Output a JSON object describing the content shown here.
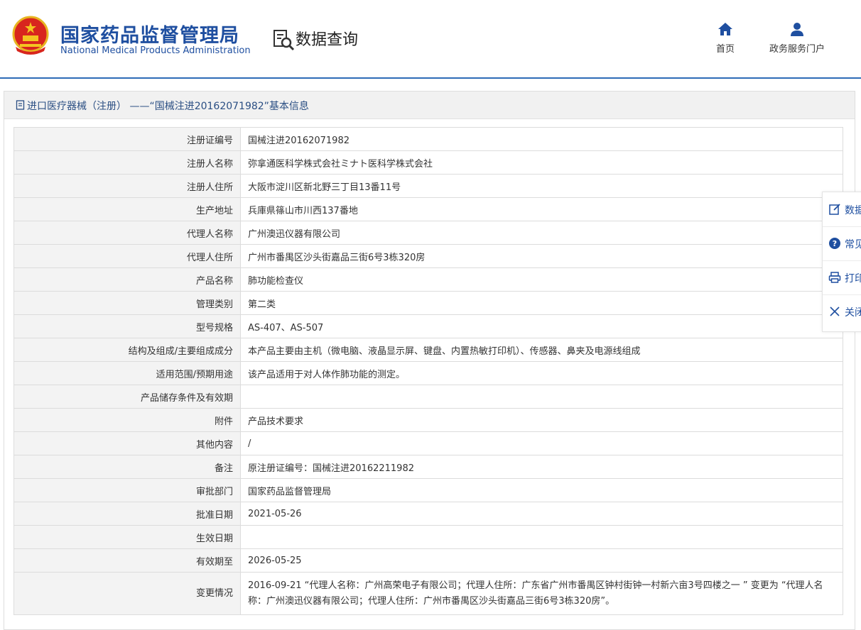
{
  "header": {
    "title_cn": "国家药品监督管理局",
    "title_en": "National Medical Products Administration",
    "section": "数据查询",
    "nav": [
      {
        "label": "首页",
        "icon": "home-icon"
      },
      {
        "label": "政务服务门户",
        "icon": "user-icon"
      }
    ]
  },
  "panel": {
    "title": "进口医疗器械（注册） ——“国械注进20162071982”基本信息"
  },
  "rows": [
    {
      "k": "注册证编号",
      "v": "国械注进20162071982"
    },
    {
      "k": "注册人名称",
      "v": "弥拿通医科学株式会社ミナト医科学株式会社"
    },
    {
      "k": "注册人住所",
      "v": "大阪市淀川区新北野三丁目13番11号"
    },
    {
      "k": "生产地址",
      "v": "兵庫県篠山市川西137番地"
    },
    {
      "k": "代理人名称",
      "v": "广州澳迅仪器有限公司"
    },
    {
      "k": "代理人住所",
      "v": "广州市番禺区沙头街嘉品三街6号3栋320房"
    },
    {
      "k": "产品名称",
      "v": "肺功能检查仪"
    },
    {
      "k": "管理类别",
      "v": "第二类"
    },
    {
      "k": "型号规格",
      "v": "AS-407、AS-507"
    },
    {
      "k": "结构及组成/主要组成成分",
      "v": "本产品主要由主机（微电脑、液晶显示屏、键盘、内置热敏打印机）、传感器、鼻夹及电源线组成"
    },
    {
      "k": "适用范围/预期用途",
      "v": "该产品适用于对人体作肺功能的测定。"
    },
    {
      "k": "产品储存条件及有效期",
      "v": ""
    },
    {
      "k": "附件",
      "v": "产品技术要求"
    },
    {
      "k": "其他内容",
      "v": "/"
    },
    {
      "k": "备注",
      "v": "原注册证编号：国械注进20162211982"
    },
    {
      "k": "审批部门",
      "v": "国家药品监督管理局"
    },
    {
      "k": "批准日期",
      "v": "2021-05-26"
    },
    {
      "k": "生效日期",
      "v": ""
    },
    {
      "k": "有效期至",
      "v": "2026-05-25"
    },
    {
      "k": "变更情况",
      "v": "2016-09-21 “代理人名称：广州高荣电子有限公司；代理人住所：广东省广州市番禺区钟村街钟一村新六亩3号四楼之一 ” 变更为 “代理人名称：广州澳迅仪器有限公司；代理人住所：广州市番禺区沙头街嘉品三街6号3栋320房”。"
    }
  ],
  "float_bar": [
    {
      "label": "数据",
      "icon": "edit-icon"
    },
    {
      "label": "常见",
      "icon": "help-icon"
    },
    {
      "label": "打印",
      "icon": "printer-icon"
    },
    {
      "label": "关闭",
      "icon": "close-icon"
    }
  ],
  "colors": {
    "brand": "#1f4fa0",
    "line": "#2d6bb7"
  }
}
